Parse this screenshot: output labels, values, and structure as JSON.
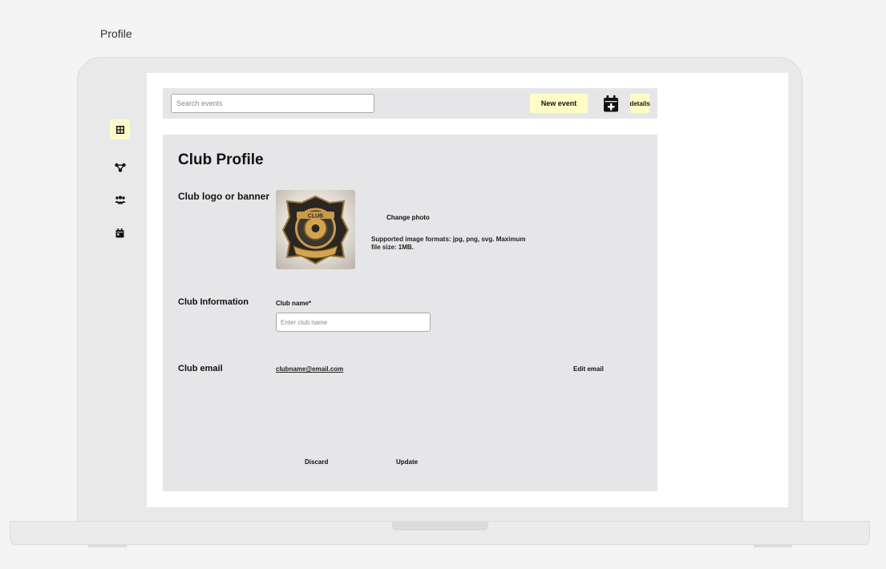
{
  "frame_label": "Profile",
  "search": {
    "placeholder": "Search events"
  },
  "header": {
    "new_event_label": "New event",
    "details_label": "details"
  },
  "sidebar": {
    "items": [
      {
        "icon": "dashboard-grid-icon",
        "active": true
      },
      {
        "icon": "network-nodes-icon",
        "active": false
      },
      {
        "icon": "members-icon",
        "active": false
      },
      {
        "icon": "calendar-icon",
        "active": false
      }
    ]
  },
  "profile": {
    "title": "Club Profile",
    "logo_section_label": "Club logo or banner",
    "change_photo_label": "Change photo",
    "formats_help": "Supported image formats: jpg, png, svg. Maximum file size: 1MB.",
    "logo_text": "CLUB",
    "info_section_label": "Club Information",
    "club_name_label": "Club name*",
    "club_name_placeholder": "Enter club name",
    "email_section_label": "Club email",
    "email_value": "clubname@email.com",
    "edit_email_label": "Edit email",
    "discard_label": "Discard",
    "update_label": "Update"
  },
  "colors": {
    "accent": "#fffcc5",
    "panel": "#e6e6e9",
    "sidebar": "#e9e9ea"
  }
}
